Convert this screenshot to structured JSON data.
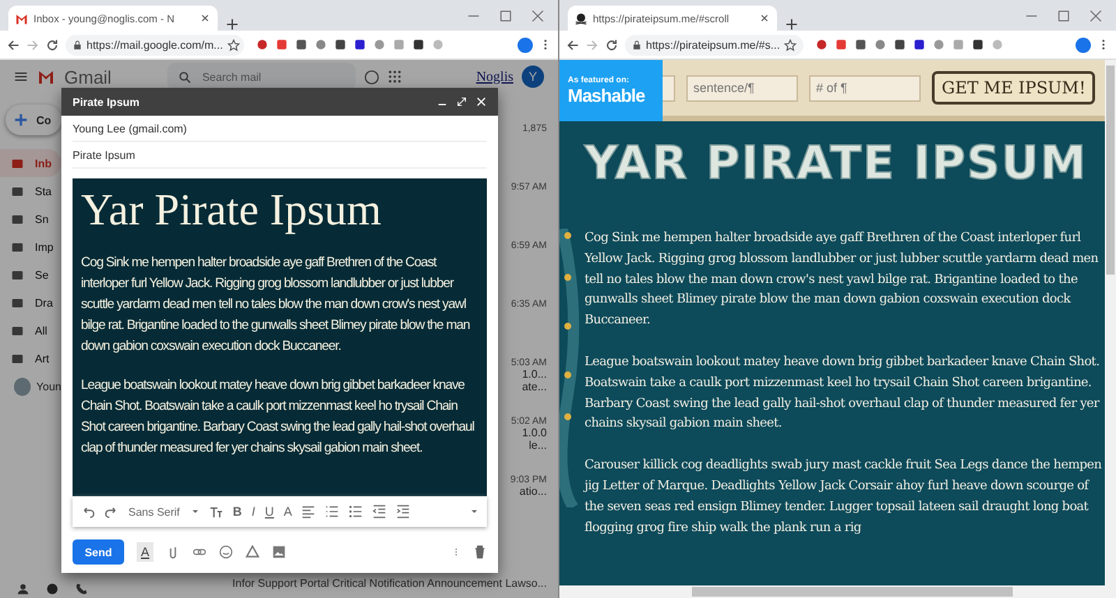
{
  "left_window": {
    "tab": {
      "title": "Inbox - young@noglis.com - N"
    },
    "url": "https://mail.google.com/m...",
    "gmail": {
      "logo_text": "Gmail",
      "search": {
        "placeholder": "Search mail"
      },
      "brand": "Noglis",
      "avatar": "Y",
      "compose_label": "Co",
      "sidebar_items": [
        {
          "label": "Inb",
          "selected": true
        },
        {
          "label": "Sta",
          "selected": false
        },
        {
          "label": "Sn",
          "selected": false
        },
        {
          "label": "Imp",
          "selected": false
        },
        {
          "label": "Se",
          "selected": false
        },
        {
          "label": "Dra",
          "selected": false
        },
        {
          "label": "All",
          "selected": false
        },
        {
          "label": "Art",
          "selected": false
        }
      ],
      "account": "Youn",
      "list_rows": [
        {
          "time": "1,875",
          "line": ""
        },
        {
          "time": "9:57 AM",
          "line": ""
        },
        {
          "time": "6:59 AM",
          "line": ""
        },
        {
          "time": "6:35 AM",
          "line": ""
        },
        {
          "time": "5:03 AM",
          "line": "1.0...",
          "line2": "ate..."
        },
        {
          "time": "5:02 AM",
          "line": "1.0.0",
          "line2": "le..."
        },
        {
          "time": "9:03 PM",
          "line": "atio..."
        }
      ],
      "bottom_subject": "Infor Support Portal Critical Notification Announcement Lawso..."
    },
    "compose": {
      "title": "Pirate Ipsum",
      "to": "Young Lee (gmail.com)",
      "subject": "Pirate Ipsum",
      "heading": "Yar Pirate Ipsum",
      "paragraphs": [
        "Cog Sink me hempen halter broadside aye gaff Brethren of the Coast interloper furl Yellow Jack. Rigging grog blossom landlubber or just lubber scuttle yardarm dead men tell no tales blow the man down crow's nest yawl bilge rat. Brigantine loaded to the gunwalls sheet Blimey pirate blow the man down gabion coxswain execution dock Buccaneer.",
        "League boatswain lookout matey heave down brig gibbet barkadeer knave Chain Shot. Boatswain take a caulk port mizzenmast keel ho trysail Chain Shot careen brigantine. Barbary Coast swing the lead gally hail-shot overhaul clap of thunder measured fer yer chains skysail gabion main sheet."
      ],
      "font": "Sans Serif",
      "format_letters": [
        "B",
        "I",
        "U",
        "A"
      ],
      "send": "Send",
      "format_toggle": "A"
    }
  },
  "right_window": {
    "tab": {
      "title": "https://pirateipsum.me/#scroll"
    },
    "url": "https://pirateipsum.me/#s...",
    "badge": {
      "caption": "As featured on:",
      "name": "Mashable"
    },
    "inputs": [
      {
        "placeholder": "sentence/¶"
      },
      {
        "placeholder": "# of ¶"
      }
    ],
    "button": "GET ME IPSUM!",
    "title": "YAR PIRATE IPSUM",
    "paragraphs": [
      "Cog Sink me hempen halter broadside aye gaff Brethren of the Coast interloper furl Yellow Jack. Rigging grog blossom landlubber or just lubber scuttle yardarm dead men tell no tales blow the man down crow's nest yawl bilge rat. Brigantine loaded to the gunwalls sheet Blimey pirate blow the man down gabion coxswain execution dock Buccaneer.",
      "League boatswain lookout matey heave down brig gibbet barkadeer knave Chain Shot. Boatswain take a caulk port mizzenmast keel ho trysail Chain Shot careen brigantine. Barbary Coast swing the lead gally hail-shot overhaul clap of thunder measured fer yer chains skysail gabion main sheet.",
      "Carouser killick cog deadlights swab jury mast cackle fruit Sea Legs dance the hempen jig Letter of Marque. Deadlights Yellow Jack Corsair ahoy furl heave down scourge of the seven seas red ensign Blimey tender. Lugger topsail lateen sail draught long boat flogging grog fire ship walk the plank run a rig"
    ]
  }
}
